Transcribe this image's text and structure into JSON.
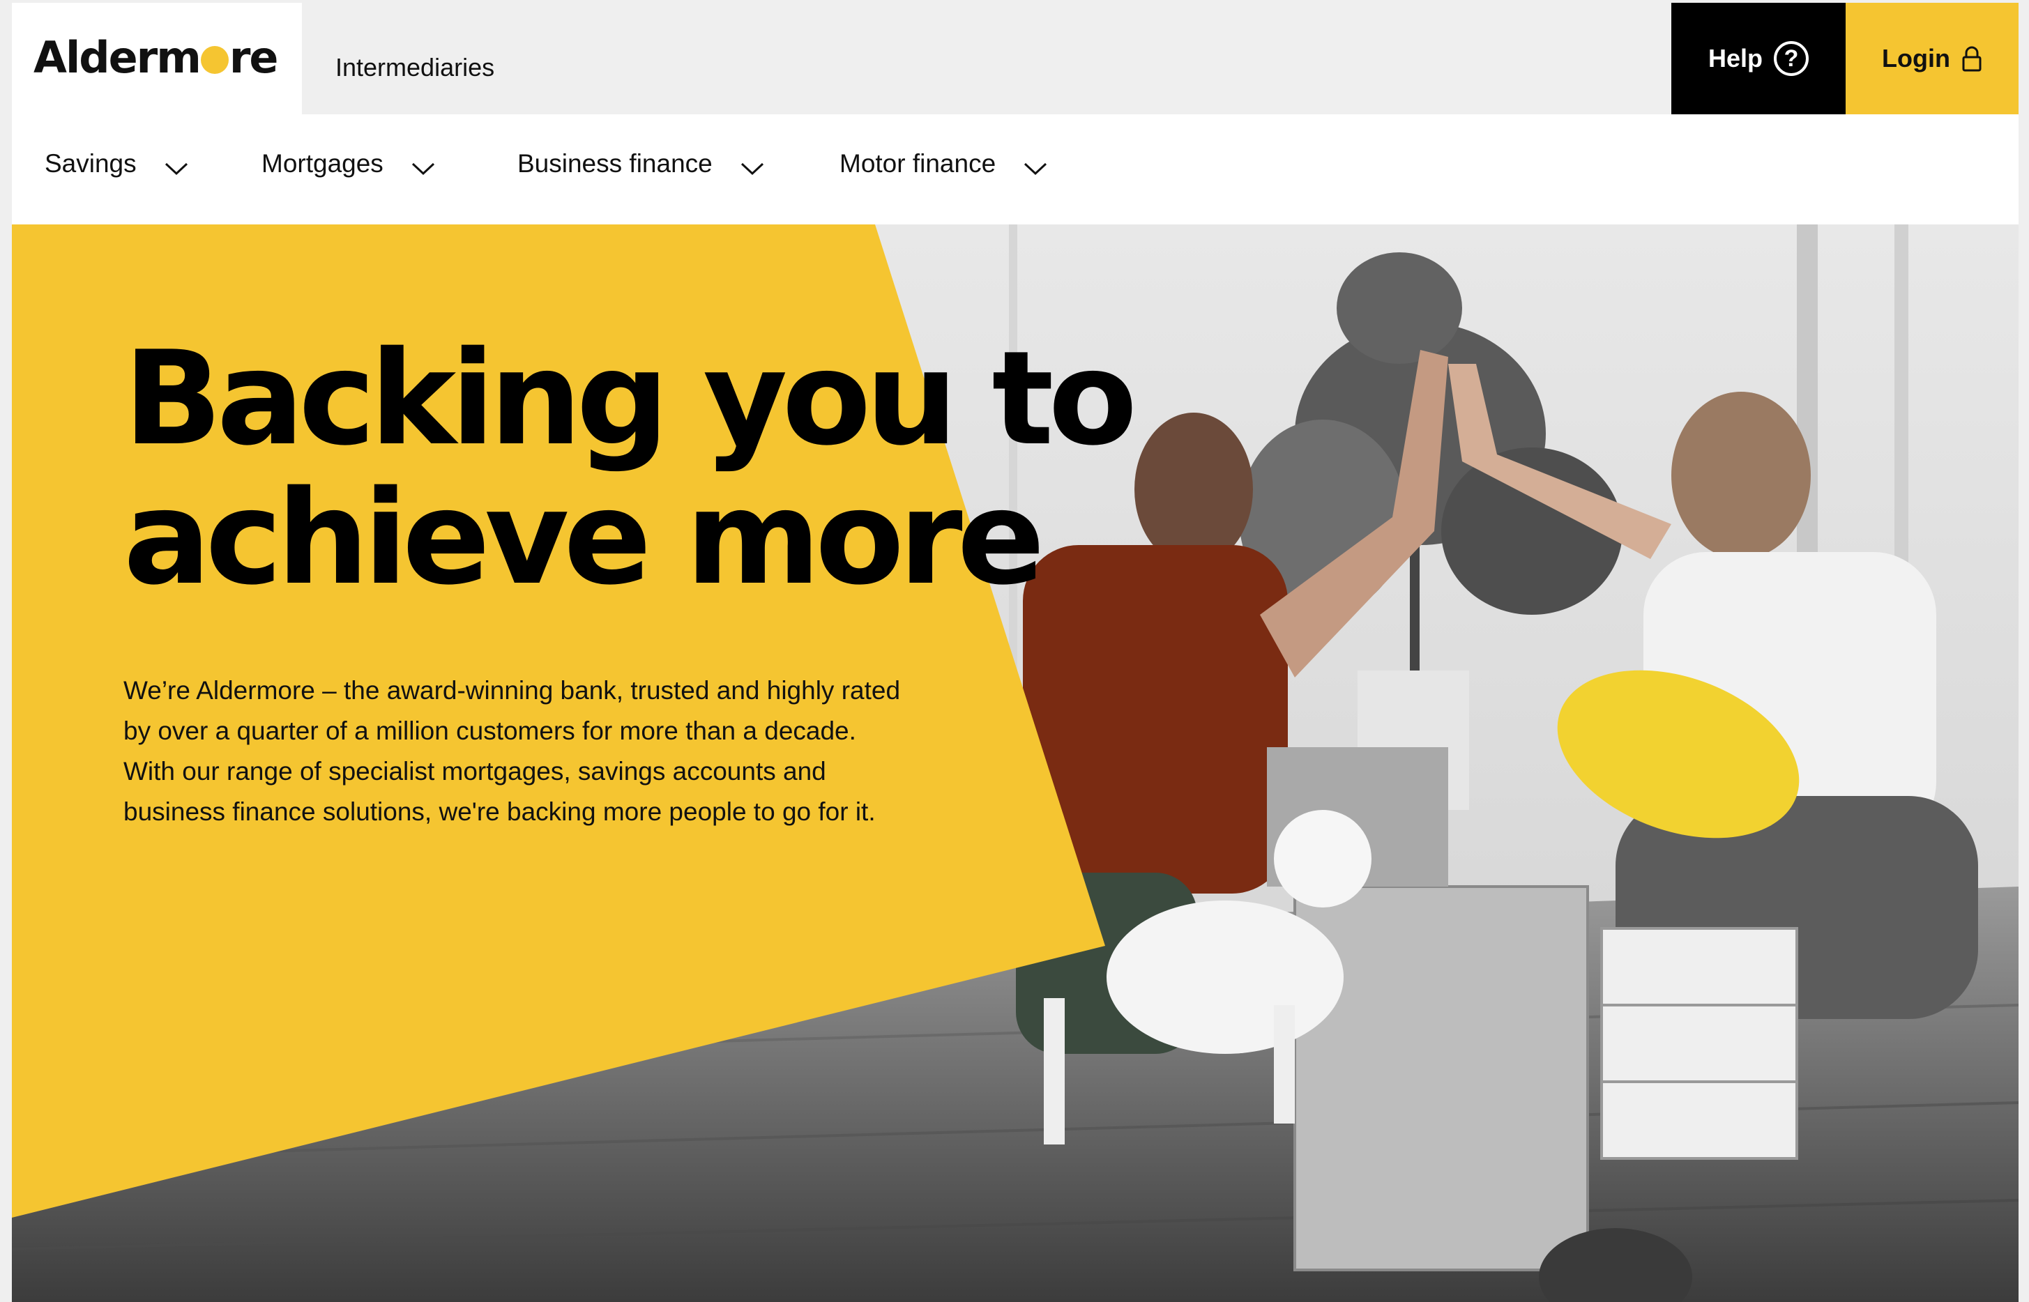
{
  "brand": {
    "logo_text_before": "Alderm",
    "logo_text_after": "re",
    "accent_color": "#f5c531"
  },
  "topbar": {
    "intermediaries_label": "Intermediaries",
    "help_label": "Help",
    "help_icon": "question-circle-icon",
    "login_label": "Login",
    "login_icon": "padlock-icon"
  },
  "nav": {
    "items": [
      {
        "label": "Savings",
        "icon": "chevron-down-icon"
      },
      {
        "label": "Mortgages",
        "icon": "chevron-down-icon"
      },
      {
        "label": "Business finance",
        "icon": "chevron-down-icon"
      },
      {
        "label": "Motor finance",
        "icon": "chevron-down-icon"
      }
    ]
  },
  "hero": {
    "headline_line1": "Backing you to",
    "headline_line2": "achieve more",
    "intro": "We’re Aldermore – the award-winning bank, trusted and highly rated by over a quarter of a million customers for more than a decade. With our range of specialist mortgages, savings accounts and business finance solutions, we're backing more people to go for it."
  }
}
